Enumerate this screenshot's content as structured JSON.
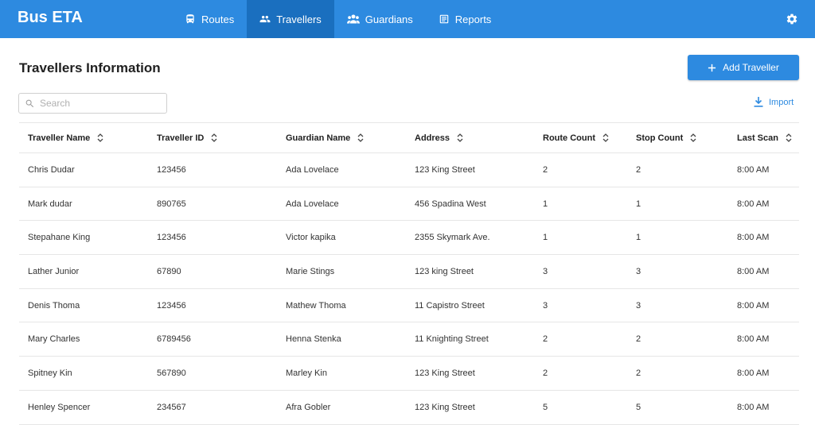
{
  "app": {
    "title": "Bus ETA"
  },
  "nav": {
    "routes": "Routes",
    "travellers": "Travellers",
    "guardians": "Guardians",
    "reports": "Reports"
  },
  "page": {
    "title": "Travellers Information",
    "add_button": "Add Traveller",
    "import": "Import"
  },
  "search": {
    "placeholder": "Search",
    "value": ""
  },
  "table": {
    "columns": [
      "Traveller Name",
      "Traveller ID",
      "Guardian Name",
      "Address",
      "Route Count",
      "Stop Count",
      "Last Scan"
    ],
    "rows": [
      [
        "Chris Dudar",
        "123456",
        "Ada Lovelace",
        "123 King Street",
        "2",
        "2",
        "8:00 AM"
      ],
      [
        "Mark dudar",
        "890765",
        "Ada Lovelace",
        "456 Spadina West",
        "1",
        "1",
        "8:00 AM"
      ],
      [
        "Stepahane King",
        "123456",
        "Victor kapika",
        "2355 Skymark Ave.",
        "1",
        "1",
        "8:00 AM"
      ],
      [
        "Lather Junior",
        "67890",
        "Marie Stings",
        "123 king Street",
        "3",
        "3",
        "8:00 AM"
      ],
      [
        "Denis Thoma",
        "123456",
        "Mathew Thoma",
        "11 Capistro Street",
        "3",
        "3",
        "8:00 AM"
      ],
      [
        "Mary Charles",
        "6789456",
        "Henna Stenka",
        "11 Knighting Street",
        "2",
        "2",
        "8:00 AM"
      ],
      [
        "Spitney Kin",
        "567890",
        "Marley Kin",
        "123 King Street",
        "2",
        "2",
        "8:00 AM"
      ],
      [
        "Henley Spencer",
        "234567",
        "Afra Gobler",
        "123 King Street",
        "5",
        "5",
        "8:00 AM"
      ]
    ]
  },
  "colors": {
    "primary": "#2d8ae0",
    "nav_active": "#1a6fbf",
    "text": "#212121"
  },
  "icons": {
    "nav": [
      "bus-icon",
      "travellers-icon",
      "guardians-icon",
      "reports-icon"
    ],
    "settings": "gear-icon",
    "add": "plus-icon",
    "import": "download-icon",
    "search": "search-icon",
    "sort": "sort-icon"
  }
}
